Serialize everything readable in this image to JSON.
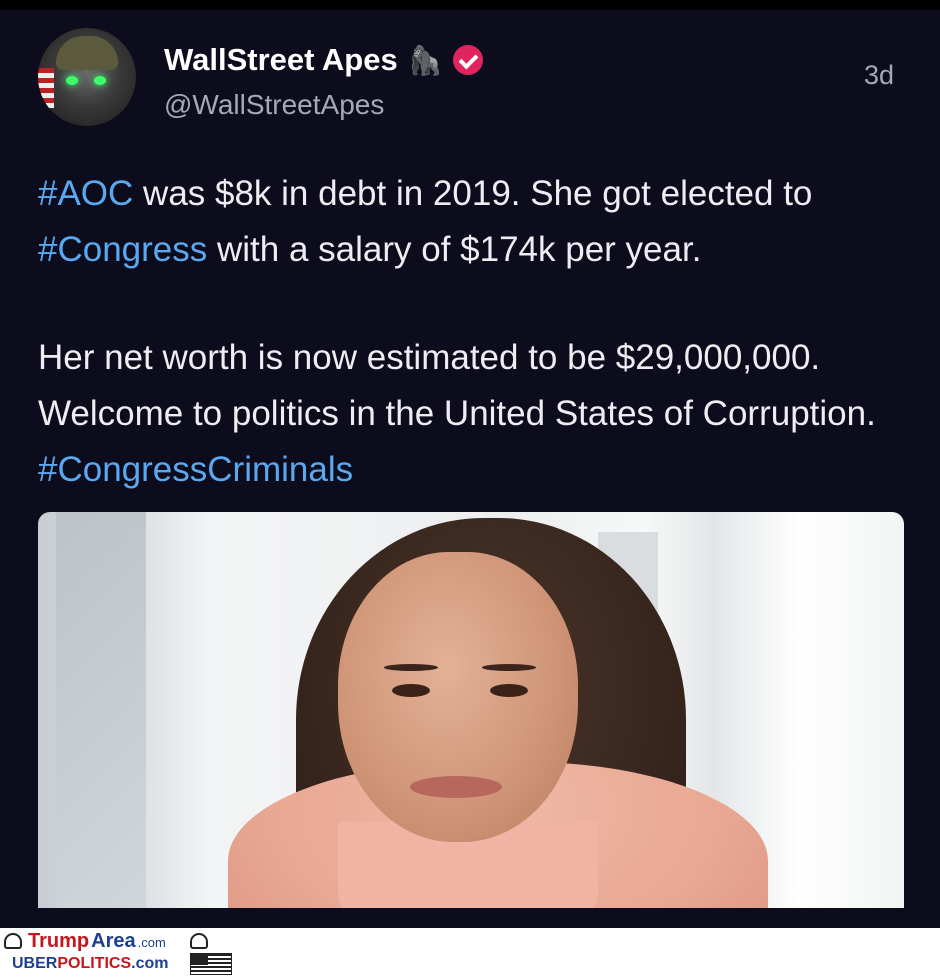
{
  "post": {
    "display_name": "WallStreet Apes",
    "name_emoji": "🦍",
    "handle": "@WallStreetApes",
    "time": "3d",
    "paragraph1": [
      {
        "text": "#AOC",
        "hashtag": true
      },
      {
        "text": " was $8k in debt in 2019. She got elected to ",
        "hashtag": false
      },
      {
        "text": "#Congress",
        "hashtag": true
      },
      {
        "text": " with a salary of $174k per year.",
        "hashtag": false
      }
    ],
    "paragraph2": [
      {
        "text": "Her net worth is now estimated to be $29,000,000. Welcome to politics in the United States of Corruption. ",
        "hashtag": false
      },
      {
        "text": "#CongressCriminals",
        "hashtag": true
      }
    ],
    "colors": {
      "background": "#0c0c1c",
      "hashtag": "#5aa9f0",
      "verified_badge": "#e0245e",
      "secondary_text": "#a7a8b2"
    }
  },
  "watermark": {
    "line1_trump": "Trump",
    "line1_area": "Area",
    "line1_com": ".com",
    "line2_uber": "UBER",
    "line2_politics": "POLITICS",
    "line2_com": ".com"
  }
}
